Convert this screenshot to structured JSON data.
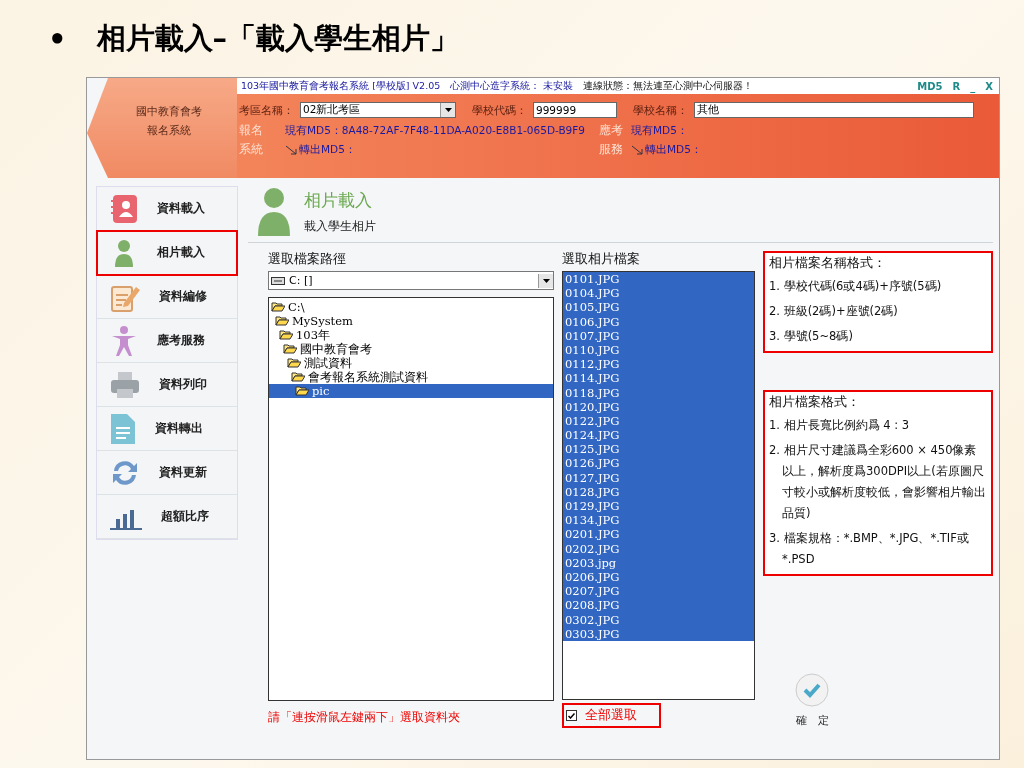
{
  "slide": {
    "bullet": "•",
    "title": "相片載入–「載入學生相片」"
  },
  "window": {
    "title": "103年國中教育會考報名系統 [學校版] V2.05",
    "font_status": "心測中心造字系統： 未安裝",
    "connection": "連線狀態：無法連至心測中心伺服器！",
    "controls": [
      "MD5",
      "R",
      "_",
      "X"
    ]
  },
  "logo": {
    "line1": "國中教育會考",
    "line2": "報名系統"
  },
  "header_fields": [
    {
      "label": "考區名稱：",
      "value": "02新北考區",
      "kind": "select"
    },
    {
      "label": "學校代碼：",
      "value": "999999",
      "kind": "text"
    },
    {
      "label": "學校名稱：",
      "value": "其他",
      "kind": "text"
    }
  ],
  "md5_groups": [
    {
      "label_1": "報名",
      "label_2": "系統",
      "current_label": "現有MD5：",
      "current_value": "8A48-72AF-7F48-11DA-A020-E8B1-065D-B9F9",
      "export_label": "轉出MD5："
    },
    {
      "label_1": "應考",
      "label_2": "服務",
      "current_label": "現有MD5：",
      "export_label": "轉出MD5："
    }
  ],
  "sidebar": {
    "items": [
      {
        "label": "資料載入",
        "kind": "contacts",
        "selected": false
      },
      {
        "label": "相片載入",
        "kind": "person",
        "selected": true
      },
      {
        "label": "資料編修",
        "kind": "edit",
        "selected": false
      },
      {
        "label": "應考服務",
        "kind": "figure",
        "selected": false
      },
      {
        "label": "資料列印",
        "kind": "printer",
        "selected": false
      },
      {
        "label": "資料轉出",
        "kind": "document",
        "selected": false
      },
      {
        "label": "資料更新",
        "kind": "refresh",
        "selected": false
      },
      {
        "label": "超額比序",
        "kind": "chart",
        "selected": false
      }
    ]
  },
  "page": {
    "title": "相片載入",
    "subtitle": "載入學生相片"
  },
  "path_picker": {
    "label": "選取檔案路徑",
    "drive": "C: []",
    "hint": "請「連按滑鼠左鍵兩下」選取資料夾",
    "tree": [
      {
        "label": "C:\\",
        "selected": false,
        "children": [
          {
            "label": "MySystem",
            "selected": false,
            "children": [
              {
                "label": "103年",
                "selected": false,
                "children": [
                  {
                    "label": "國中教育會考",
                    "selected": false,
                    "children": [
                      {
                        "label": "測試資料",
                        "selected": false,
                        "children": [
                          {
                            "label": "會考報名系統測試資料",
                            "selected": false,
                            "children": [
                              {
                                "label": "pic",
                                "selected": true
                              }
                            ]
                          }
                        ]
                      }
                    ]
                  }
                ]
              }
            ]
          }
        ]
      }
    ]
  },
  "file_picker": {
    "label": "選取相片檔案",
    "select_all": {
      "label": "全部選取",
      "checked": true
    },
    "files": [
      {
        "name": "0101.JPG",
        "selected": true
      },
      {
        "name": "0104.JPG",
        "selected": true
      },
      {
        "name": "0105.JPG",
        "selected": true
      },
      {
        "name": "0106.JPG",
        "selected": true
      },
      {
        "name": "0107.JPG",
        "selected": true
      },
      {
        "name": "0110.JPG",
        "selected": true
      },
      {
        "name": "0112.JPG",
        "selected": true
      },
      {
        "name": "0114.JPG",
        "selected": true
      },
      {
        "name": "0118.JPG",
        "selected": true
      },
      {
        "name": "0120.JPG",
        "selected": true
      },
      {
        "name": "0122.JPG",
        "selected": true
      },
      {
        "name": "0124.JPG",
        "selected": true
      },
      {
        "name": "0125.JPG",
        "selected": true
      },
      {
        "name": "0126.JPG",
        "selected": true
      },
      {
        "name": "0127.JPG",
        "selected": true
      },
      {
        "name": "0128.JPG",
        "selected": true
      },
      {
        "name": "0129.JPG",
        "selected": true
      },
      {
        "name": "0134.JPG",
        "selected": true
      },
      {
        "name": "0201.JPG",
        "selected": true
      },
      {
        "name": "0202.JPG",
        "selected": true
      },
      {
        "name": "0203.jpg",
        "selected": true
      },
      {
        "name": "0206.JPG",
        "selected": true
      },
      {
        "name": "0207.JPG",
        "selected": true
      },
      {
        "name": "0208.JPG",
        "selected": true
      },
      {
        "name": "0302.JPG",
        "selected": true
      },
      {
        "name": "0303.JPG",
        "selected": true
      }
    ]
  },
  "notes": [
    {
      "title": "相片檔案名稱格式：",
      "items": [
        "1. 學校代碼(6或4碼)+序號(5碼)",
        "2. 班級(2碼)+座號(2碼)",
        "3. 學號(5~8碼)"
      ]
    },
    {
      "title": "相片檔案格式：",
      "items": [
        "1. 相片長寬比例約爲 4 : 3",
        "2. 相片尺寸建議爲全彩600 × 450像素以上，解析度爲300DPI以上(若原圖尺寸較小或解析度較低，會影響相片輸出品質)",
        "3. 檔案規格：*.BMP、*.JPG、*.TIF或*.PSD"
      ]
    }
  ],
  "confirm_button": {
    "label": "確　定"
  }
}
